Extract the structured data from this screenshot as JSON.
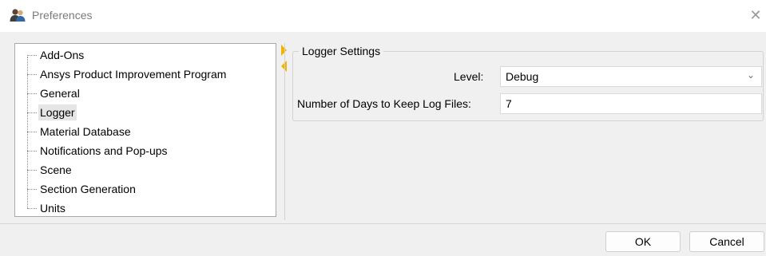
{
  "window": {
    "title": "Preferences",
    "close_glyph": "✕",
    "icon": "users-icon"
  },
  "tree": {
    "selected": "Logger",
    "items": [
      {
        "label": "Add-Ons"
      },
      {
        "label": "Ansys Product Improvement Program"
      },
      {
        "label": "General"
      },
      {
        "label": "Logger"
      },
      {
        "label": "Material Database"
      },
      {
        "label": "Notifications and Pop-ups"
      },
      {
        "label": "Scene"
      },
      {
        "label": "Section Generation"
      },
      {
        "label": "Units"
      }
    ]
  },
  "logger_settings": {
    "group_title": "Logger Settings",
    "level_label": "Level:",
    "level_value": "Debug",
    "days_label": "Number of Days to Keep Log Files:",
    "days_value": "7"
  },
  "buttons": {
    "ok": "OK",
    "cancel": "Cancel"
  },
  "colors": {
    "splitter_arrows": "#f0b400",
    "selected_item_bg": "#e5e5e5"
  }
}
